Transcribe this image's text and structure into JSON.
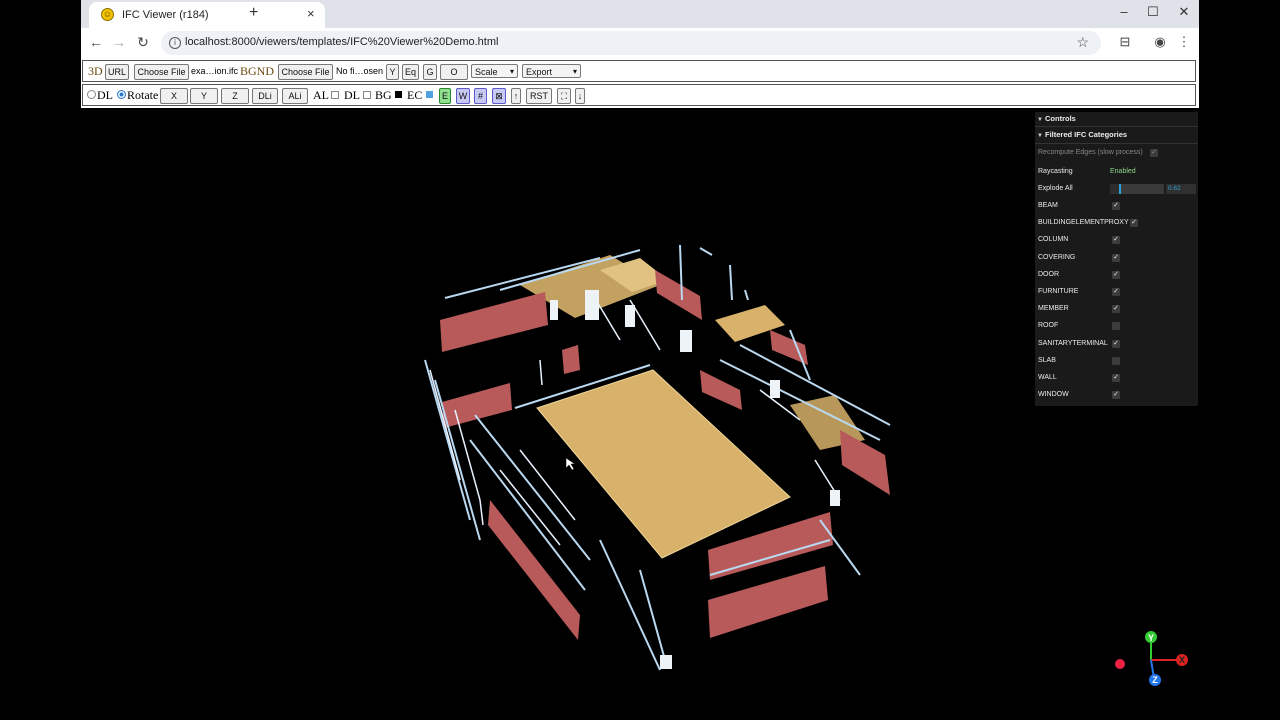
{
  "browser": {
    "tab_title": "IFC Viewer (r184)",
    "new_tab_label": "+",
    "url": "localhost:8000/viewers/templates/IFC%20Viewer%20Demo.html"
  },
  "toolbar1": {
    "label_3d": "3D",
    "url_button": "URL",
    "choose_file_1": "Choose File",
    "file_name_1": "exa…ion.ifc",
    "label_bgnd": "BGND",
    "choose_file_2": "Choose File",
    "file_name_2": "No fi…osen",
    "btn_y": "Y",
    "btn_eq": "Eq",
    "btn_g": "G",
    "btn_o": "O",
    "scale_select": "Scale",
    "export_select": "Export"
  },
  "toolbar2": {
    "radio_dl": "DL",
    "radio_rotate": "Rotate",
    "btn_x": "X",
    "btn_y": "Y",
    "btn_z": "Z",
    "btn_dli": "DLi",
    "btn_ali": "ALi",
    "label_al": "AL",
    "label_dl": "DL",
    "label_bg": "BG",
    "label_ec": "EC",
    "btn_e": "E",
    "btn_w": "W",
    "btn_hash": "#",
    "btn_rst": "RST"
  },
  "panel": {
    "controls_title": "Controls",
    "filtered_title": "Filtered IFC Categories",
    "recompute_label": "Recompute Edges (slow process)",
    "raycasting_label": "Raycasting",
    "raycasting_value": "Enabled",
    "explode_label": "Explode All",
    "explode_value": "0.62",
    "explode_fraction": 0.62,
    "categories": [
      {
        "name": "BEAM",
        "checked": true
      },
      {
        "name": "BUILDINGELEMENTPROXY",
        "checked": true
      },
      {
        "name": "COLUMN",
        "checked": true
      },
      {
        "name": "COVERING",
        "checked": true
      },
      {
        "name": "DOOR",
        "checked": true
      },
      {
        "name": "FURNITURE",
        "checked": true
      },
      {
        "name": "MEMBER",
        "checked": true
      },
      {
        "name": "ROOF",
        "checked": false
      },
      {
        "name": "SANITARYTERMINAL",
        "checked": true
      },
      {
        "name": "SLAB",
        "checked": false
      },
      {
        "name": "WALL",
        "checked": true
      },
      {
        "name": "WINDOW",
        "checked": true
      }
    ]
  },
  "axes": {
    "y": "Y",
    "x": "X",
    "z": "Z"
  },
  "colors": {
    "wall": "#b85a5a",
    "slab": "#d8b26a",
    "window": "#b9d8f0",
    "accent": "#2fa1d6",
    "axis_y": "#33cc33",
    "axis_x": "#dd2222",
    "axis_z": "#2277ee"
  }
}
